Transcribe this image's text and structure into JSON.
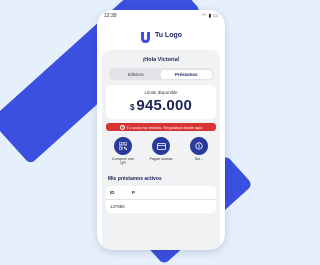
{
  "status_bar": {
    "time": "12:30"
  },
  "brand": {
    "logo_text": "Tu Logo",
    "color": "#3b4fe0"
  },
  "greeting": "¡Hola Victoria!",
  "tabs": [
    {
      "label": "Billetera",
      "active": false
    },
    {
      "label": "Préstamos",
      "active": true
    }
  ],
  "limit": {
    "label": "Límite disponible",
    "currency": "$",
    "amount": "945.000"
  },
  "alert": {
    "text": "Tu cuota ha vencido. Regularizá desde aquí"
  },
  "actions": [
    {
      "label": "Comprar con QR",
      "icon": "qr-icon"
    },
    {
      "label": "Pagar cuotas",
      "icon": "card-icon"
    },
    {
      "label": "Sol...",
      "icon": "coin-icon"
    }
  ],
  "loans_section": {
    "title": "Mis préstamos activos",
    "columns": [
      "ID",
      "P"
    ],
    "rows": [
      [
        "137685",
        ""
      ]
    ]
  },
  "colors": {
    "alert": "#d93434",
    "action": "#2a3a9c",
    "background": "#e6f0fb"
  }
}
